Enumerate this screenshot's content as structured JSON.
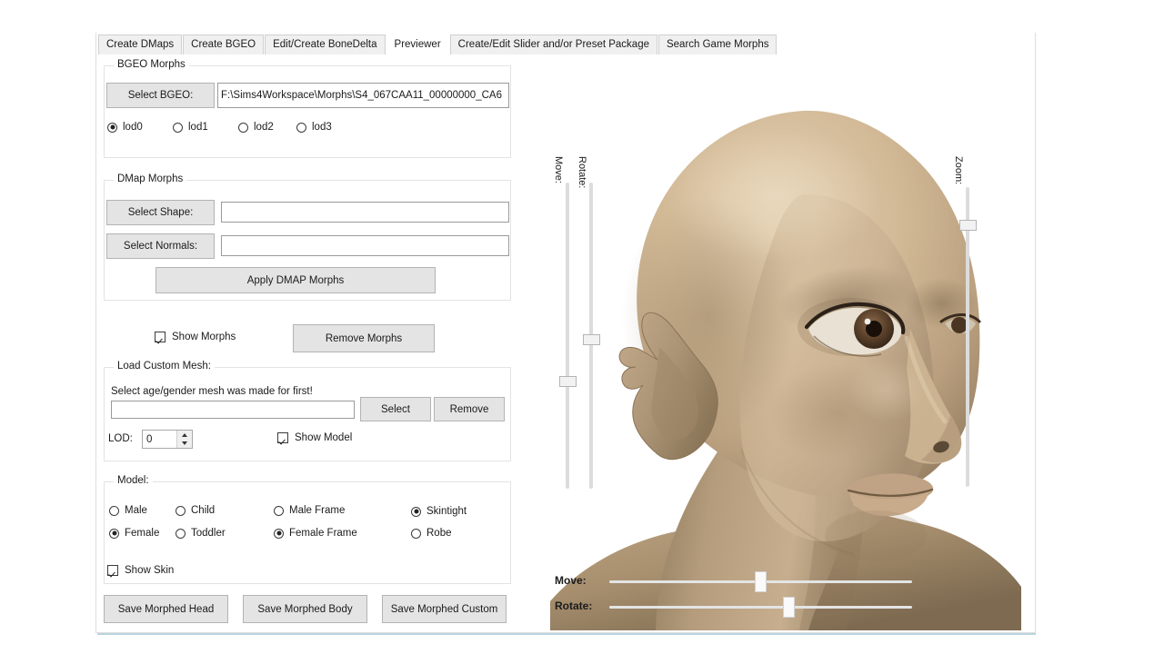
{
  "window": {
    "tabs": [
      {
        "label": "Create DMaps",
        "active": false
      },
      {
        "label": "Create BGEO",
        "active": false
      },
      {
        "label": "Edit/Create BoneDelta",
        "active": false
      },
      {
        "label": "Previewer",
        "active": true
      },
      {
        "label": "Create/Edit Slider and/or Preset Package",
        "active": false
      },
      {
        "label": "Search Game Morphs",
        "active": false
      }
    ]
  },
  "bgeo_morphs": {
    "legend": "BGEO Morphs",
    "select_button": "Select BGEO:",
    "path_value": "F:\\Sims4Workspace\\Morphs\\S4_067CAA11_00000000_CA6",
    "lod_options": [
      {
        "label": "lod0",
        "selected": true
      },
      {
        "label": "lod1",
        "selected": false
      },
      {
        "label": "lod2",
        "selected": false
      },
      {
        "label": "lod3",
        "selected": false
      }
    ]
  },
  "dmap_morphs": {
    "legend": "DMap Morphs",
    "select_shape_button": "Select Shape:",
    "shape_value": "",
    "select_normals_button": "Select Normals:",
    "normals_value": "",
    "apply_button": "Apply DMAP Morphs"
  },
  "morph_actions": {
    "show_morphs_label": "Show Morphs",
    "show_morphs_checked": true,
    "remove_morphs_button": "Remove Morphs"
  },
  "load_custom_mesh": {
    "legend": "Load Custom Mesh:",
    "hint": "Select age/gender mesh was made for first!",
    "path_value": "",
    "select_button": "Select",
    "remove_button": "Remove",
    "lod_label": "LOD:",
    "lod_value": "0",
    "show_model_label": "Show Model",
    "show_model_checked": true
  },
  "model": {
    "legend": "Model:",
    "age_options": [
      {
        "label": "Male",
        "selected": false
      },
      {
        "label": "Female",
        "selected": true
      },
      {
        "label": "Child",
        "selected": false
      },
      {
        "label": "Toddler",
        "selected": false
      }
    ],
    "frame_options": [
      {
        "label": "Male Frame",
        "selected": false
      },
      {
        "label": "Female Frame",
        "selected": true
      }
    ],
    "outfit_options": [
      {
        "label": "Skintight",
        "selected": true
      },
      {
        "label": "Robe",
        "selected": false
      }
    ],
    "show_skin_label": "Show Skin",
    "show_skin_checked": true
  },
  "save_buttons": {
    "head": "Save Morphed Head",
    "body": "Save Morphed Body",
    "custom": "Save Morphed Custom"
  },
  "viewport": {
    "vertical_sliders": [
      {
        "name": "move",
        "label": "Move:",
        "value_pct": 68
      },
      {
        "name": "rotate",
        "label": "Rotate:",
        "value_pct": 57
      },
      {
        "name": "zoom",
        "label": "Zoom:",
        "value_pct": 14
      }
    ],
    "horizontal_sliders": [
      {
        "name": "move",
        "label": "Move:",
        "value_pct": 49
      },
      {
        "name": "rotate",
        "label": "Rotate:",
        "value_pct": 59
      }
    ],
    "model_description": "bald female sim head with pointed elf ears, three-quarter view"
  },
  "colors": {
    "skin_light": "#d9c4a6",
    "skin_mid": "#c2a988",
    "skin_shadow": "#8d7a61",
    "tab_inactive": "#f0f0f0",
    "button_face": "#e4e4e4",
    "accent_rule": "#b9d4e0"
  }
}
